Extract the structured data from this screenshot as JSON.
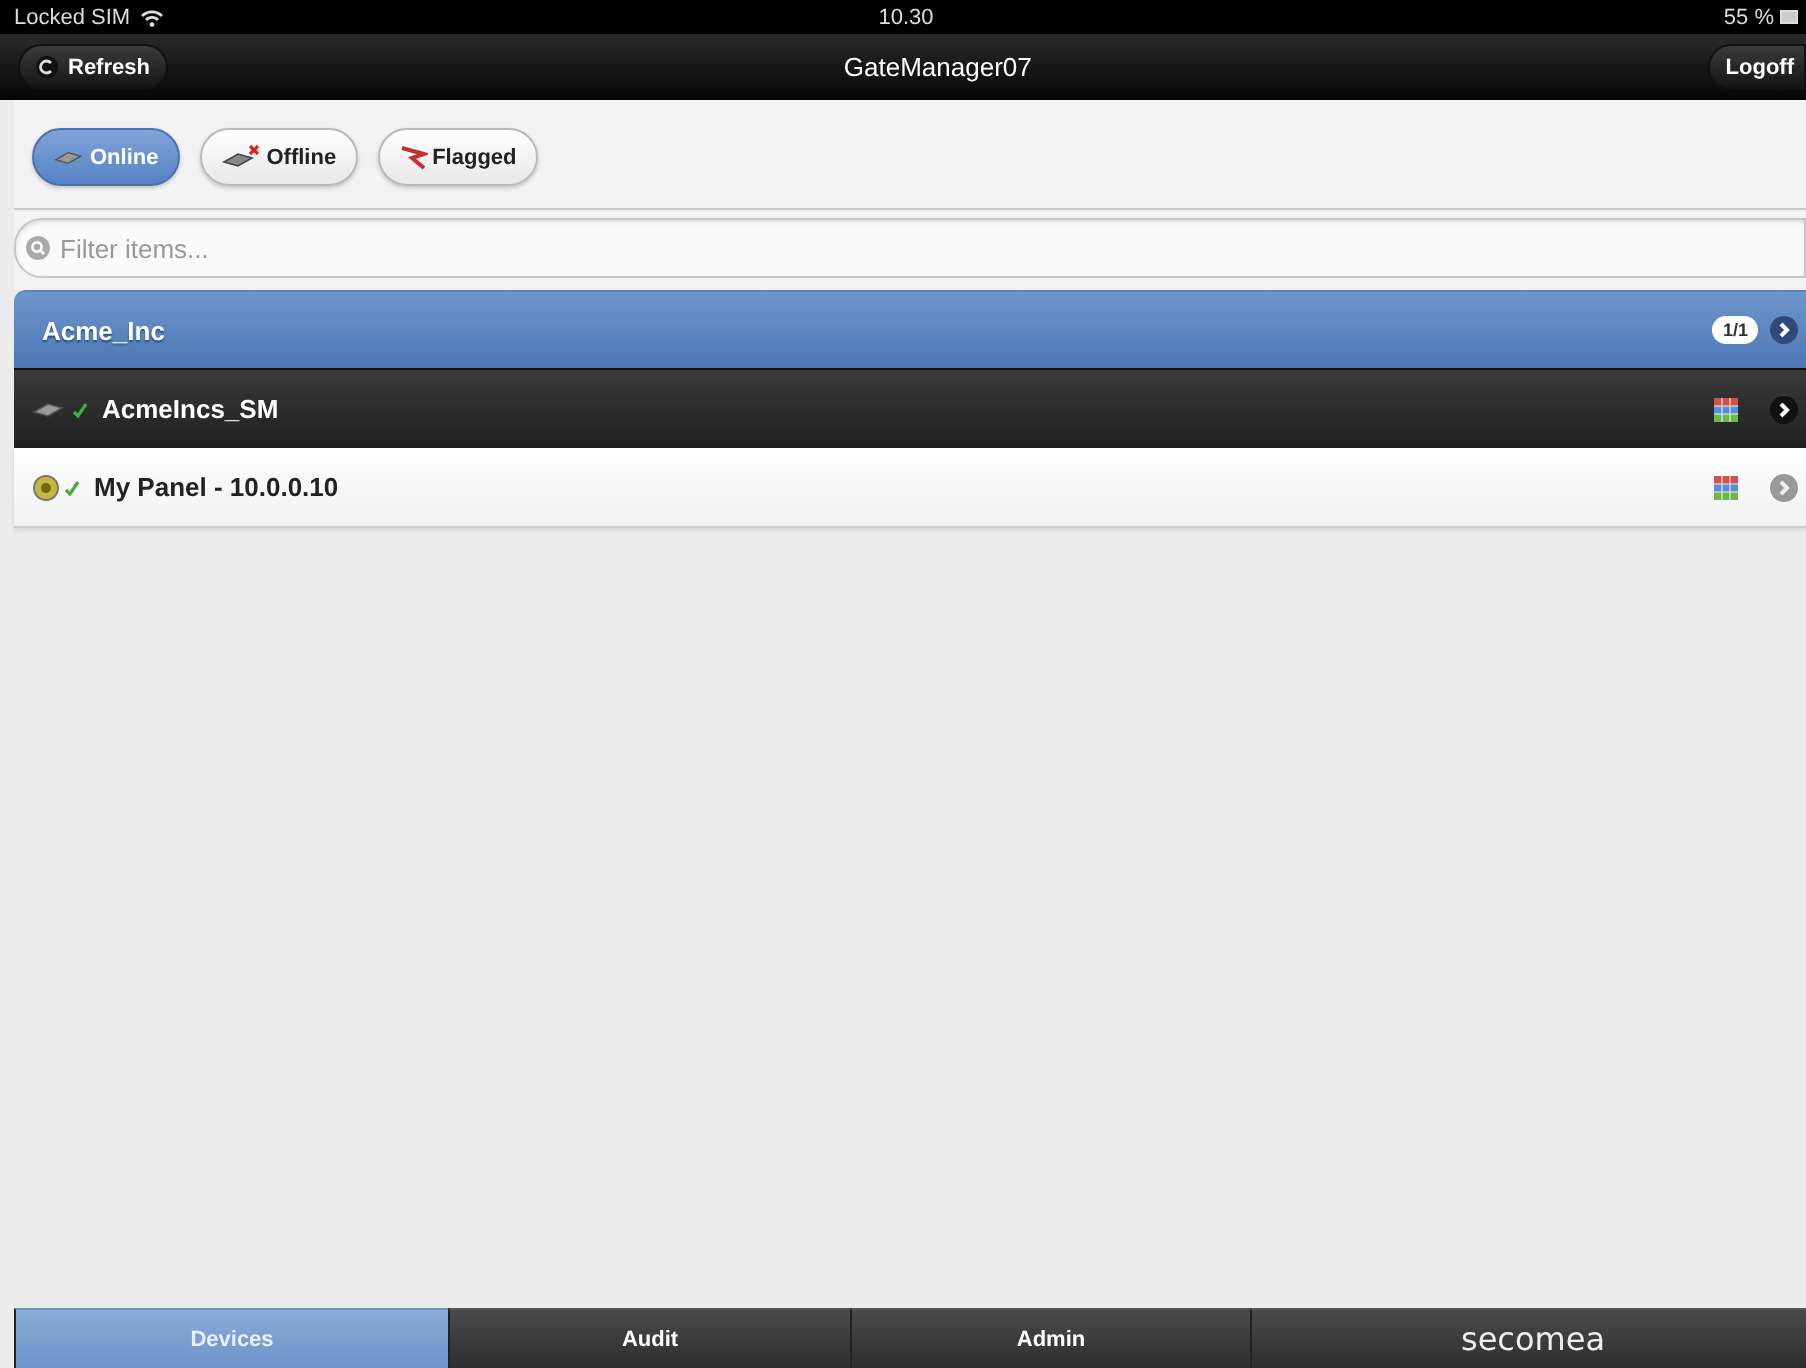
{
  "status_bar": {
    "carrier": "Locked SIM",
    "time": "10.30",
    "battery": "55 %"
  },
  "header": {
    "title": "GateManager07",
    "left_button": "Refresh",
    "right_button": "Logoff"
  },
  "filters": [
    {
      "label": "Online",
      "kind": "online",
      "selected": true
    },
    {
      "label": "Offline",
      "kind": "offline",
      "selected": false
    },
    {
      "label": "Flagged",
      "kind": "flagged",
      "selected": false
    }
  ],
  "search": {
    "placeholder": "Filter items..."
  },
  "group": {
    "title": "Acme_Inc",
    "count": "1/1"
  },
  "rows": [
    {
      "label": "AcmeIncs_SM",
      "kind": "node"
    },
    {
      "label": "My Panel - 10.0.0.10",
      "kind": "device"
    }
  ],
  "tabs": [
    {
      "label": "Devices",
      "kind": "text",
      "selected": true
    },
    {
      "label": "Audit",
      "kind": "text",
      "selected": false
    },
    {
      "label": "Admin",
      "kind": "text",
      "selected": false
    },
    {
      "label": "secomea",
      "kind": "logo",
      "selected": false
    }
  ]
}
